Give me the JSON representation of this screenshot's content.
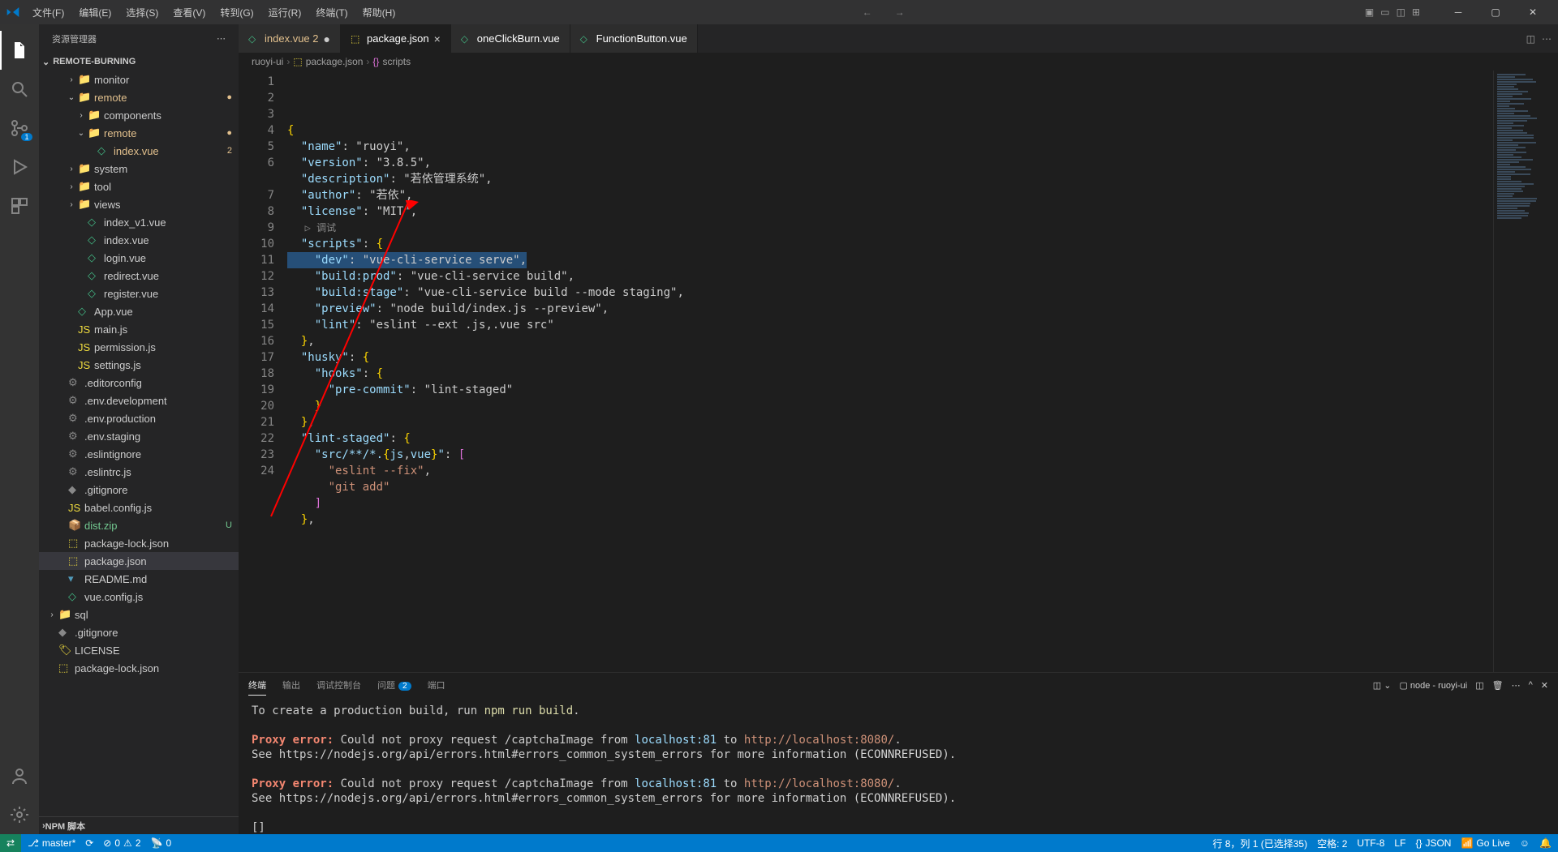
{
  "menubar": {
    "items": [
      "文件(F)",
      "编辑(E)",
      "选择(S)",
      "查看(V)",
      "转到(G)",
      "运行(R)",
      "终端(T)",
      "帮助(H)"
    ]
  },
  "sidebar": {
    "title": "资源管理器",
    "section": "REMOTE-BURNING",
    "npm_section": "NPM 脚本",
    "tree": [
      {
        "indent": 2,
        "chev": "›",
        "type": "folder",
        "label": "monitor"
      },
      {
        "indent": 2,
        "chev": "⌄",
        "type": "folder",
        "label": "remote",
        "modified": true,
        "badge": "●"
      },
      {
        "indent": 3,
        "chev": "›",
        "type": "folder",
        "label": "components"
      },
      {
        "indent": 3,
        "chev": "⌄",
        "type": "folder",
        "label": "remote",
        "modified": true,
        "badge": "●"
      },
      {
        "indent": 4,
        "chev": "",
        "type": "vue",
        "label": "index.vue",
        "modified": true,
        "badge": "2"
      },
      {
        "indent": 2,
        "chev": "›",
        "type": "folder",
        "label": "system"
      },
      {
        "indent": 2,
        "chev": "›",
        "type": "folder",
        "label": "tool"
      },
      {
        "indent": 2,
        "chev": "›",
        "type": "folder-red",
        "label": "views"
      },
      {
        "indent": 3,
        "chev": "",
        "type": "vue",
        "label": "index_v1.vue"
      },
      {
        "indent": 3,
        "chev": "",
        "type": "vue",
        "label": "index.vue"
      },
      {
        "indent": 3,
        "chev": "",
        "type": "vue",
        "label": "login.vue"
      },
      {
        "indent": 3,
        "chev": "",
        "type": "vue",
        "label": "redirect.vue"
      },
      {
        "indent": 3,
        "chev": "",
        "type": "vue",
        "label": "register.vue"
      },
      {
        "indent": 2,
        "chev": "",
        "type": "vue",
        "label": "App.vue"
      },
      {
        "indent": 2,
        "chev": "",
        "type": "js",
        "label": "main.js"
      },
      {
        "indent": 2,
        "chev": "",
        "type": "js",
        "label": "permission.js"
      },
      {
        "indent": 2,
        "chev": "",
        "type": "js",
        "label": "settings.js"
      },
      {
        "indent": 1,
        "chev": "",
        "type": "config",
        "label": ".editorconfig"
      },
      {
        "indent": 1,
        "chev": "",
        "type": "config",
        "label": ".env.development"
      },
      {
        "indent": 1,
        "chev": "",
        "type": "config",
        "label": ".env.production"
      },
      {
        "indent": 1,
        "chev": "",
        "type": "config",
        "label": ".env.staging"
      },
      {
        "indent": 1,
        "chev": "",
        "type": "config",
        "label": ".eslintignore"
      },
      {
        "indent": 1,
        "chev": "",
        "type": "config",
        "label": ".eslintrc.js"
      },
      {
        "indent": 1,
        "chev": "",
        "type": "git",
        "label": ".gitignore"
      },
      {
        "indent": 1,
        "chev": "",
        "type": "js",
        "label": "babel.config.js"
      },
      {
        "indent": 1,
        "chev": "",
        "type": "zip",
        "label": "dist.zip",
        "untracked": true,
        "badge": "U"
      },
      {
        "indent": 1,
        "chev": "",
        "type": "json",
        "label": "package-lock.json"
      },
      {
        "indent": 1,
        "chev": "",
        "type": "json",
        "label": "package.json",
        "selected": true
      },
      {
        "indent": 1,
        "chev": "",
        "type": "md",
        "label": "README.md"
      },
      {
        "indent": 1,
        "chev": "",
        "type": "vue",
        "label": "vue.config.js"
      },
      {
        "indent": 0,
        "chev": "›",
        "type": "folder-red",
        "label": "sql"
      },
      {
        "indent": 0,
        "chev": "",
        "type": "git",
        "label": ".gitignore"
      },
      {
        "indent": 0,
        "chev": "",
        "type": "license",
        "label": "LICENSE"
      },
      {
        "indent": 0,
        "chev": "",
        "type": "json",
        "label": "package-lock.json"
      }
    ]
  },
  "activitybar": {
    "scm_badge": "1"
  },
  "tabs": {
    "items": [
      {
        "icon": "vue",
        "label": "index.vue",
        "modified": true,
        "dirty_badge": "2"
      },
      {
        "icon": "json",
        "label": "package.json",
        "active": true,
        "close": true
      },
      {
        "icon": "vue",
        "label": "oneClickBurn.vue"
      },
      {
        "icon": "vue",
        "label": "FunctionButton.vue"
      }
    ]
  },
  "breadcrumb": [
    "ruoyi-ui",
    "package.json",
    "scripts"
  ],
  "editor": {
    "debug_hint": "▷ 调试",
    "lines": [
      {
        "n": 1,
        "t": "{",
        "kind": "brace"
      },
      {
        "n": 2,
        "t": "  \"name\": \"ruoyi\",",
        "kind": "kv"
      },
      {
        "n": 3,
        "t": "  \"version\": \"3.8.5\",",
        "kind": "kv"
      },
      {
        "n": 4,
        "t": "  \"description\": \"若依管理系统\",",
        "kind": "kv"
      },
      {
        "n": 5,
        "t": "  \"author\": \"若依\",",
        "kind": "kv"
      },
      {
        "n": 6,
        "t": "  \"license\": \"MIT\",",
        "kind": "kv"
      },
      {
        "n": "",
        "t": "   ▷ 调试",
        "kind": "hint"
      },
      {
        "n": 7,
        "t": "  \"scripts\": {",
        "kind": "kv_open"
      },
      {
        "n": 8,
        "t": "    \"dev\": \"vue-cli-service serve\",",
        "kind": "kv",
        "selected": true
      },
      {
        "n": 9,
        "t": "    \"build:prod\": \"vue-cli-service build\",",
        "kind": "kv"
      },
      {
        "n": 10,
        "t": "    \"build:stage\": \"vue-cli-service build --mode staging\",",
        "kind": "kv"
      },
      {
        "n": 11,
        "t": "    \"preview\": \"node build/index.js --preview\",",
        "kind": "kv"
      },
      {
        "n": 12,
        "t": "    \"lint\": \"eslint --ext .js,.vue src\"",
        "kind": "kv"
      },
      {
        "n": 13,
        "t": "  },",
        "kind": "close"
      },
      {
        "n": 14,
        "t": "  \"husky\": {",
        "kind": "kv_open"
      },
      {
        "n": 15,
        "t": "    \"hooks\": {",
        "kind": "kv_open"
      },
      {
        "n": 16,
        "t": "      \"pre-commit\": \"lint-staged\"",
        "kind": "kv"
      },
      {
        "n": 17,
        "t": "    }",
        "kind": "close"
      },
      {
        "n": 18,
        "t": "  },",
        "kind": "close"
      },
      {
        "n": 19,
        "t": "  \"lint-staged\": {",
        "kind": "kv_open"
      },
      {
        "n": 20,
        "t": "    \"src/**/*.{js,vue}\": [",
        "kind": "kv_arr"
      },
      {
        "n": 21,
        "t": "      \"eslint --fix\",",
        "kind": "str"
      },
      {
        "n": 22,
        "t": "      \"git add\"",
        "kind": "str"
      },
      {
        "n": 23,
        "t": "    ]",
        "kind": "close_arr"
      },
      {
        "n": 24,
        "t": "  },",
        "kind": "close"
      }
    ]
  },
  "panel": {
    "tabs": [
      {
        "label": "终端",
        "active": true
      },
      {
        "label": "输出"
      },
      {
        "label": "调试控制台"
      },
      {
        "label": "问题",
        "count": "2"
      },
      {
        "label": "端口"
      }
    ],
    "terminal_name": "node - ruoyi-ui",
    "terminal": {
      "build_prefix": "  To create a production build, run ",
      "build_cmd": "npm run build",
      "build_suffix": ".",
      "err_label": "Proxy error:",
      "err_line1": " Could not proxy request ",
      "req_path": "/captchaImage",
      "from": " from ",
      "host1": "localhost:81",
      "to": " to ",
      "url1": "http://localhost:8080/",
      "dot": ".",
      "see_line": "See https://nodejs.org/api/errors.html#errors_common_system_errors for more information (",
      "econn": "ECONNREFUSED",
      "paren_close": ").",
      "prompt": "[]"
    }
  },
  "statusbar": {
    "branch": "master*",
    "errors": "0",
    "warnings": "2",
    "ports": "0",
    "ln_col": "行 8，列 1 (已选择35)",
    "spaces": "空格: 2",
    "encoding": "UTF-8",
    "eol": "LF",
    "language": "JSON",
    "golive": "Go Live"
  }
}
